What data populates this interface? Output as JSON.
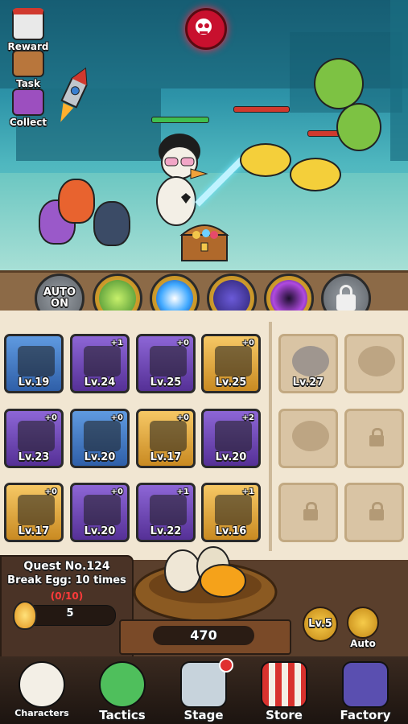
{
  "side_menu": [
    {
      "label": "Reward",
      "icon": "calendar-icon"
    },
    {
      "label": "Task",
      "icon": "clipboard-icon"
    },
    {
      "label": "Collect",
      "icon": "book-icon"
    }
  ],
  "skills": [
    {
      "label": "AUTO\nON",
      "icon": "auto-icon",
      "state": "grey"
    },
    {
      "icon": "poison-potion-icon",
      "state": "gold"
    },
    {
      "icon": "lightning-orb-icon",
      "state": "gold"
    },
    {
      "icon": "dagger-icon",
      "state": "gold"
    },
    {
      "icon": "vortex-icon",
      "state": "gold"
    },
    {
      "icon": "lock-icon",
      "state": "grey"
    }
  ],
  "equipment": [
    {
      "icon": "lightsaber-icon",
      "level": "Lv.19",
      "plus": "",
      "rarity": "blue"
    },
    {
      "icon": "belt-icon",
      "level": "Lv.24",
      "plus": "+1",
      "rarity": "purple"
    },
    {
      "icon": "boots-icon",
      "level": "Lv.25",
      "plus": "+0",
      "rarity": "purple"
    },
    {
      "icon": "armor-icon",
      "level": "Lv.25",
      "plus": "+0",
      "rarity": "gold"
    },
    {
      "icon": "shield-icon",
      "level": "Lv.23",
      "plus": "+0",
      "rarity": "purple"
    },
    {
      "icon": "horn-icon",
      "level": "Lv.20",
      "plus": "+0",
      "rarity": "blue"
    },
    {
      "icon": "book-icon",
      "level": "Lv.17",
      "plus": "+0",
      "rarity": "gold"
    },
    {
      "icon": "hair-icon",
      "level": "Lv.20",
      "plus": "+2",
      "rarity": "purple"
    },
    {
      "icon": "ladybug-icon",
      "level": "Lv.17",
      "plus": "+0",
      "rarity": "gold"
    },
    {
      "icon": "heart-icon",
      "level": "Lv.20",
      "plus": "+0",
      "rarity": "purple"
    },
    {
      "icon": "flower-icon",
      "level": "Lv.22",
      "plus": "+1",
      "rarity": "purple"
    },
    {
      "icon": "heart-glasses-icon",
      "level": "Lv.16",
      "plus": "+1",
      "rarity": "gold"
    }
  ],
  "extra_slots": [
    {
      "icon": "rocket-icon",
      "level": "Lv.27",
      "state": "owned"
    },
    {
      "icon": "planet-icon",
      "level": "",
      "state": "locked"
    },
    {
      "icon": "wing-icon",
      "level": "",
      "state": "locked"
    },
    {
      "icon": "lock-icon",
      "level": "",
      "state": "locked"
    },
    {
      "icon": "lock-icon",
      "level": "",
      "state": "locked"
    },
    {
      "icon": "lock-icon",
      "level": "",
      "state": "locked"
    }
  ],
  "quest": {
    "title": "Quest No.124",
    "task": "Break Egg: 10 times",
    "progress": "(0/10)",
    "reward_count": "5"
  },
  "egg": {
    "count": "470",
    "level": "Lv.5",
    "auto_label": "Auto"
  },
  "nav": [
    {
      "label": "Characters",
      "icon": "duck-character-icon"
    },
    {
      "label": "Tactics",
      "icon": "tactics-icon"
    },
    {
      "label": "Stage",
      "icon": "crossed-swords-icon"
    },
    {
      "label": "Store",
      "icon": "shop-icon"
    },
    {
      "label": "Factory",
      "icon": "factory-icon"
    }
  ],
  "colors": {
    "accent": "#f3c64b",
    "danger": "#c8102e",
    "panel": "#f1e6d2"
  }
}
